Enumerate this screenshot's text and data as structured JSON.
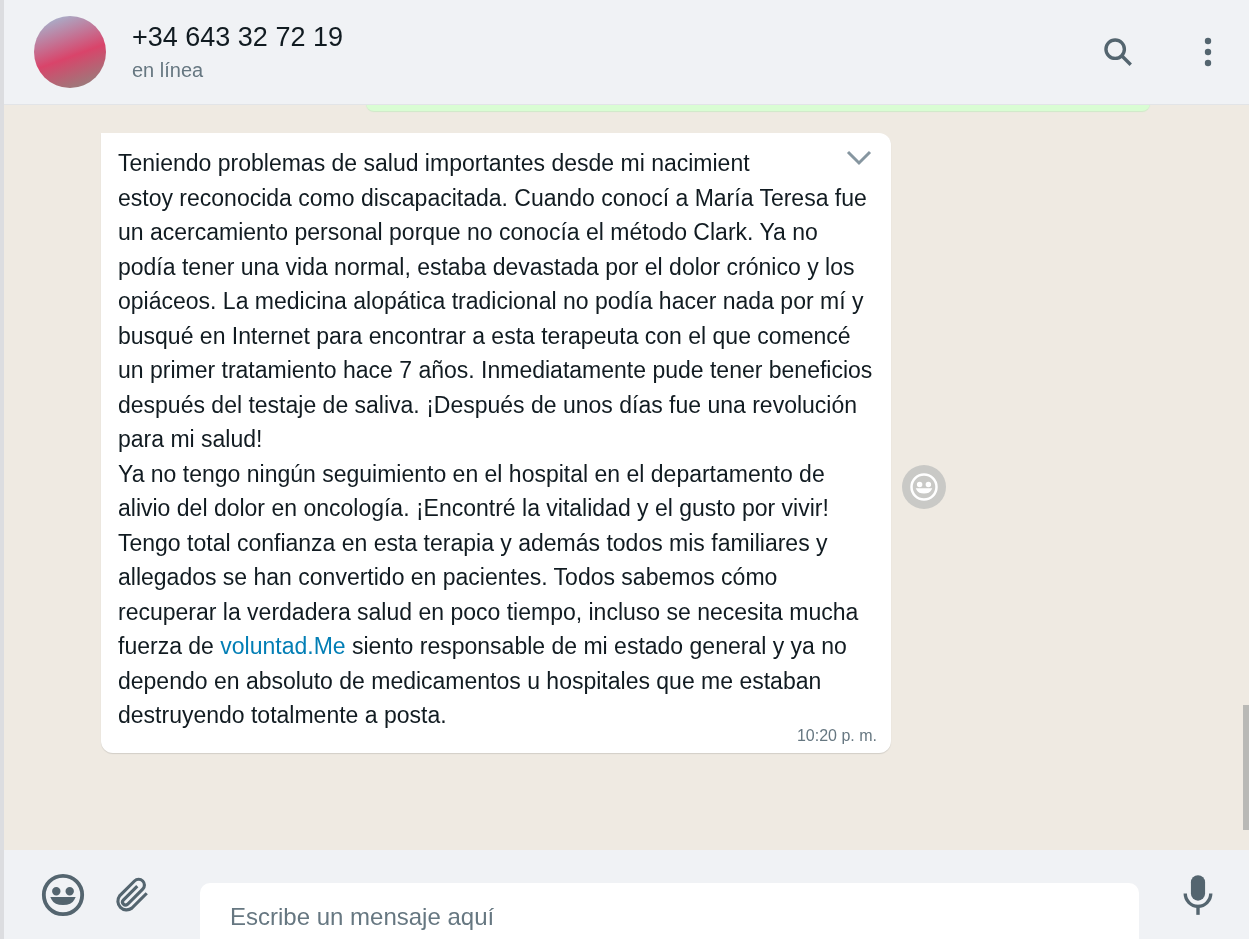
{
  "header": {
    "title": "+34 643 32 72 19",
    "status": "en línea"
  },
  "message": {
    "first_line": "Teniendo problemas de salud importantes desde mi nacimient",
    "paragraphs": [
      {
        "text": "estoy reconocida como discapacitada. Cuando conocí a María Teresa fue un acercamiento personal porque no conocía el método Clark. Ya no podía tener una vida normal, estaba devastada por el dolor crónico y los opiáceos. La medicina alopática tradicional no podía hacer nada por mí y busqué en Internet para encontrar a esta terapeuta con el que comencé un primer tratamiento hace 7 años. Inmediatamente pude tener beneficios después del testaje de saliva. ¡Después de unos días fue una revolución para mi salud!"
      },
      {
        "text": "Ya no tengo ningún seguimiento en el hospital en el departamento de alivio del dolor en oncología. ¡Encontré la vitalidad y el gusto por vivir!"
      },
      {
        "text": "Tengo total confianza en esta terapia y además todos mis familiares y allegados se han convertido en pacientes. Todos sabemos cómo recuperar la verdadera salud en poco tiempo, incluso se necesita mucha fuerza de ",
        "link": "voluntad.Me",
        "after": " siento responsable de mi estado general y ya no dependo en absoluto de medicamentos u hospitales que me estaban destruyendo totalmente a posta."
      }
    ],
    "time": "10:20 p. m."
  },
  "composer": {
    "placeholder": "Escribe un mensaje aquí"
  }
}
